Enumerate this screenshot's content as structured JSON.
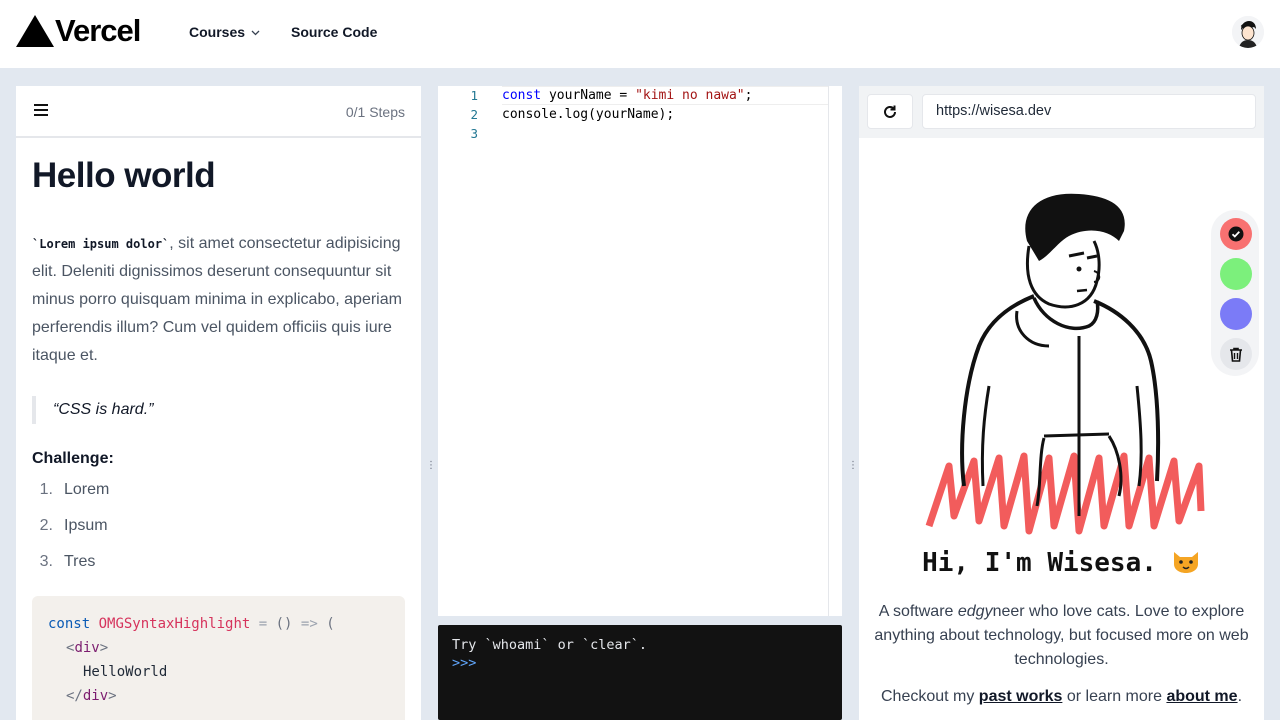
{
  "header": {
    "logo_text": "Vercel",
    "nav": {
      "courses_label": "Courses",
      "source_label": "Source Code"
    }
  },
  "lesson": {
    "steps": "0/1 Steps",
    "title": "Hello world",
    "inline_code": "`Lorem ipsum dolor`",
    "paragraph": ", sit amet consectetur adipisicing elit. Deleniti dignissimos deserunt consequuntur sit minus porro quisquam minima in explicabo, aperiam perferendis illum? Cum vel quidem officiis quis iure itaque et.",
    "quote": "“CSS is hard.”",
    "challenge_heading": "Challenge:",
    "challenge_items": [
      {
        "num": "1.",
        "label": "Lorem"
      },
      {
        "num": "2.",
        "label": "Ipsum"
      },
      {
        "num": "3.",
        "label": "Tres"
      }
    ],
    "code": {
      "l1_kw": "const",
      "l1_name": "OMGSyntaxHighlight",
      "l1_eq": "=",
      "l1_paren": "()",
      "l1_arrow": "=>",
      "l1_open": "(",
      "l2_open": "<",
      "l2_tag": "div",
      "l2_close": ">",
      "l3_text": "HelloWorld",
      "l4_open": "</",
      "l4_tag": "div",
      "l4_close": ">"
    }
  },
  "editor": {
    "line_numbers": [
      "1",
      "2",
      "3"
    ],
    "line1": {
      "kw": "const",
      "mid": " yourName = ",
      "str": "\"kimi no nawa\"",
      "end": ";"
    },
    "line2": "console.log(yourName);",
    "line3": ""
  },
  "console": {
    "hint": "Try `whoami` or `clear`.",
    "prompt": ">>>"
  },
  "preview": {
    "url": "https://wisesa.dev",
    "greeting": "Hi, I'm Wisesa.",
    "about_pre": "A software ",
    "about_em": "edgy",
    "about_post": "neer who love cats. Love to explore anything about technology, but focused more on web technologies.",
    "checkout_pre": "Checkout my ",
    "past_works": "past works",
    "checkout_mid": " or learn more ",
    "about_me": "about me",
    "checkout_end": ".",
    "palette": [
      "#f87171",
      "#7cf07c",
      "#7b7bf7"
    ]
  }
}
